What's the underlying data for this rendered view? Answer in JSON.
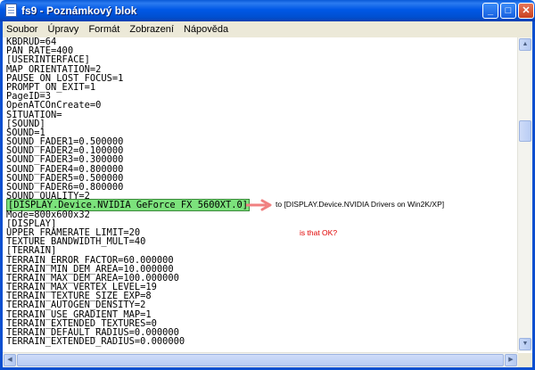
{
  "window": {
    "title": "fs9 - Poznámkový blok",
    "buttons": {
      "minimize": "_",
      "maximize": "□",
      "close": "✕"
    }
  },
  "menu": [
    "Soubor",
    "Úpravy",
    "Formát",
    "Zobrazení",
    "Nápověda"
  ],
  "editor": {
    "lines_before": [
      "KBDRUD=64",
      "PAN_RATE=400",
      "[USERINTERFACE]",
      "MAP_ORIENTATION=2",
      "PAUSE_ON_LOST_FOCUS=1",
      "PROMPT_ON_EXIT=1",
      "PageID=3",
      "OpenATCOnCreate=0",
      "SITUATION=",
      "[SOUND]",
      "SOUND=1",
      "SOUND_FADER1=0.500000",
      "SOUND_FADER2=0.100000",
      "SOUND_FADER3=0.300000",
      "SOUND_FADER4=0.800000",
      "SOUND_FADER5=0.500000",
      "SOUND_FADER6=0.800000",
      "SOUND_QUALITY=2"
    ],
    "highlighted_line": "[DISPLAY.Device.NVIDIA GeForce FX 5600XT.0]",
    "lines_after": [
      "Mode=800x600x32",
      "[DISPLAY]",
      "UPPER_FRAMERATE_LIMIT=20",
      "TEXTURE_BANDWIDTH_MULT=40",
      "[TERRAIN]",
      "TERRAIN_ERROR_FACTOR=60.000000",
      "TERRAIN_MIN_DEM_AREA=10.000000",
      "TERRAIN_MAX_DEM_AREA=100.000000",
      "TERRAIN_MAX_VERTEX_LEVEL=19",
      "TERRAIN_TEXTURE_SIZE_EXP=8",
      "TERRAIN_AUTOGEN_DENSITY=2",
      "TERRAIN_USE_GRADIENT_MAP=1",
      "TERRAIN_EXTENDED_TEXTURES=0",
      "TERRAIN_DEFAULT_RADIUS=0.000000",
      "TERRAIN_EXTENDED_RADIUS=0.000000"
    ]
  },
  "annotations": {
    "replacement": "to [DISPLAY.Device.NVIDIA Drivers on Win2K/XP]",
    "question": "is that OK?",
    "question_color": "#e00000",
    "arrow_color": "#f08080",
    "highlight_color": "#7ce27c"
  }
}
